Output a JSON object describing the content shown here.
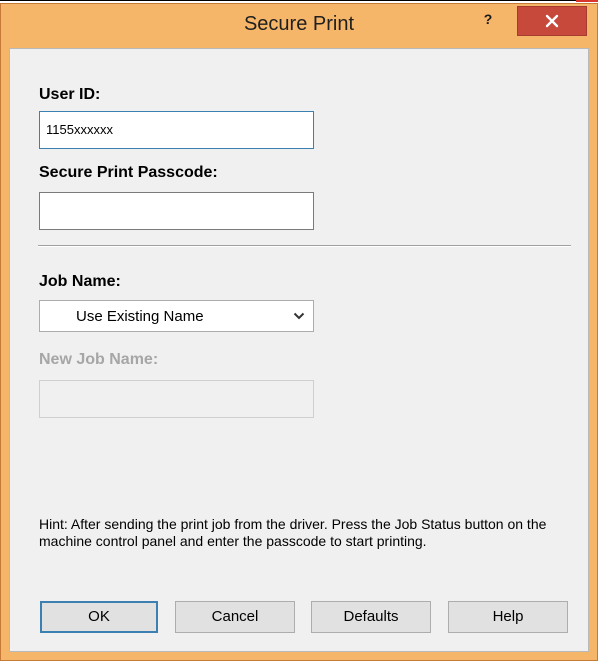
{
  "dialog": {
    "title": "Secure Print"
  },
  "form": {
    "user_id_label": "User ID:",
    "user_id_value": "1155xxxxxx",
    "passcode_label": "Secure Print Passcode:",
    "passcode_value": "",
    "job_name_label": "Job Name:",
    "job_name_selected": "Use Existing Name",
    "new_job_name_label": "New Job Name:",
    "new_job_name_value": ""
  },
  "hint": "Hint: After sending the print job from the driver. Press the Job Status button on the machine control panel and enter the passcode to start printing.",
  "buttons": {
    "ok": "OK",
    "cancel": "Cancel",
    "defaults": "Defaults",
    "help": "Help"
  },
  "colors": {
    "frame": "#f5b669",
    "close": "#c7493c",
    "focus_border": "#3c7fb1",
    "disabled_text": "#a6a6a6"
  }
}
